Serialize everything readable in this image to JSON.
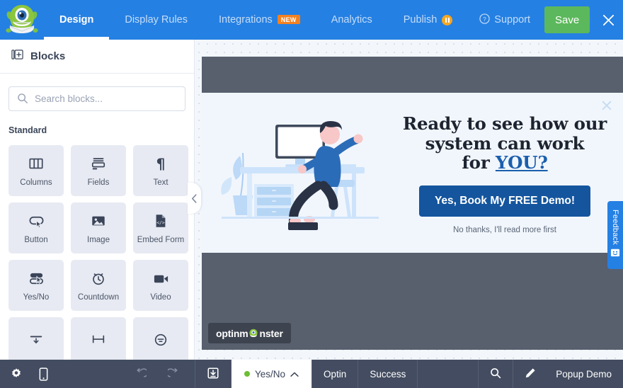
{
  "header": {
    "logo_icon": "optinmonster-monster-logo",
    "nav": [
      {
        "label": "Design",
        "active": true,
        "badge": null
      },
      {
        "label": "Display Rules",
        "active": false,
        "badge": null
      },
      {
        "label": "Integrations",
        "active": false,
        "badge": "NEW"
      },
      {
        "label": "Analytics",
        "active": false,
        "badge": null
      },
      {
        "label": "Publish",
        "active": false,
        "badge": "pause"
      }
    ],
    "support_label": "Support",
    "support_icon": "question-circle-icon",
    "save_label": "Save",
    "close_icon": "close-icon",
    "bg_color": "#2580e3",
    "save_color": "#5cb85c",
    "badge_new_color": "#f4811f",
    "badge_pause_color": "#f5a623"
  },
  "sidebar": {
    "panel_title": "Blocks",
    "panel_icon": "add-block-icon",
    "search": {
      "placeholder": "Search blocks...",
      "value": "",
      "icon": "search-icon"
    },
    "section_label": "Standard",
    "blocks": [
      {
        "label": "Columns",
        "icon": "columns-icon"
      },
      {
        "label": "Fields",
        "icon": "fields-icon"
      },
      {
        "label": "Text",
        "icon": "paragraph-icon"
      },
      {
        "label": "Button",
        "icon": "button-cursor-icon"
      },
      {
        "label": "Image",
        "icon": "image-icon"
      },
      {
        "label": "Embed Form",
        "icon": "embed-form-code-icon"
      },
      {
        "label": "Yes/No",
        "icon": "yes-no-icon"
      },
      {
        "label": "Countdown",
        "icon": "alarm-clock-icon"
      },
      {
        "label": "Video",
        "icon": "video-camera-icon"
      },
      {
        "label": "",
        "icon": "divider-icon"
      },
      {
        "label": "",
        "icon": "spacer-icon"
      },
      {
        "label": "",
        "icon": "social-icon"
      }
    ],
    "collapse_icon": "chevron-left-icon"
  },
  "canvas": {
    "popup": {
      "close_icon": "close-icon",
      "illustration": "person-at-desk-illustration",
      "headline_line1": "Ready to see how our",
      "headline_line2": "system can work",
      "headline_line3_pre": "for ",
      "headline_line3_link": "YOU?",
      "cta_label": "Yes, Book My FREE Demo!",
      "decline_label": "No thanks, I'll read more first",
      "cta_color": "#14559e",
      "link_color": "#1b5fad",
      "bg_color": "#f1f6fd"
    },
    "watermark_text": "optinm",
    "watermark_text_2": "nster",
    "watermark_icon": "monster-logo-icon"
  },
  "feedback": {
    "label": "Feedback",
    "icon": "feedback-smiley-icon",
    "color": "#2580e3"
  },
  "bottombar": {
    "settings_icon": "gear-icon",
    "mobile_icon": "mobile-device-icon",
    "undo_icon": "undo-icon",
    "redo_icon": "redo-icon",
    "save_template_icon": "save-template-icon",
    "active_tab": "Yes/No",
    "active_tab_chevron": "chevron-up-icon",
    "tabs": [
      {
        "label": "Optin"
      },
      {
        "label": "Success"
      }
    ],
    "search_icon": "search-icon",
    "edit_icon": "pencil-icon",
    "campaign_name": "Popup Demo",
    "status_dot_color": "#6cbe32",
    "bg_color": "#434c60"
  }
}
